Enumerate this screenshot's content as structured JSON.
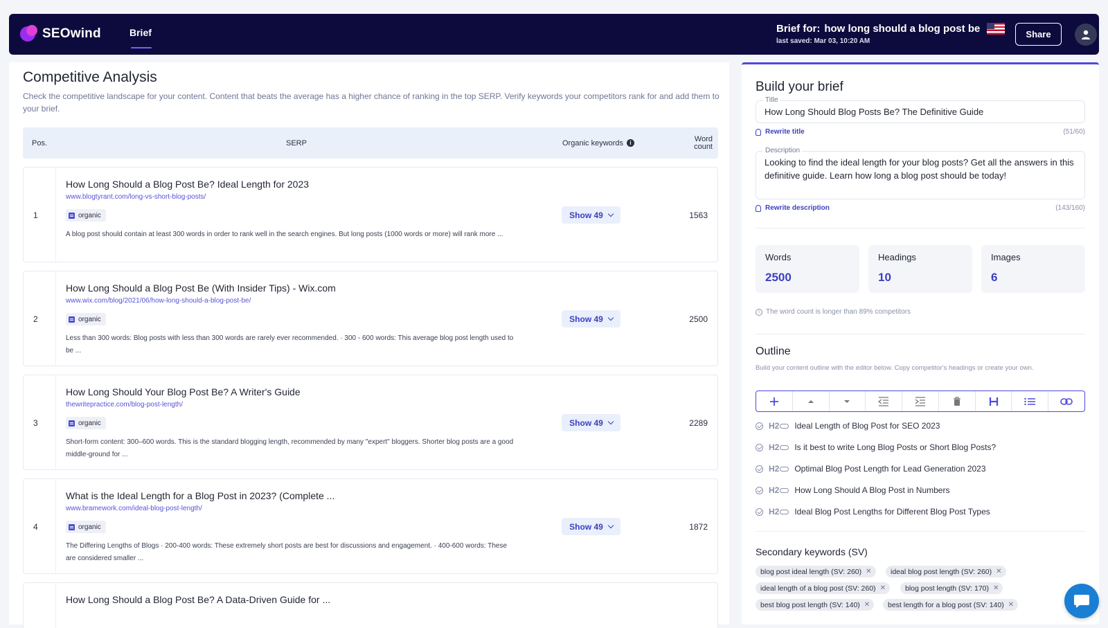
{
  "header": {
    "logo_text": "SEOwind",
    "nav_brief": "Brief",
    "brief_for_label": "Brief for:",
    "brief_keyword": "how long should a blog post be",
    "last_saved": "last saved: Mar 03, 10:20 AM",
    "share_label": "Share"
  },
  "left": {
    "title": "Competitive Analysis",
    "subtitle": "Check the competitive landscape for your content. Content that beats the average has a higher chance of ranking in the top SERP. Verify keywords your competitors rank for and add them to your brief.",
    "columns": {
      "pos": "Pos.",
      "serp": "SERP",
      "organic": "Organic keywords",
      "info": "i",
      "word_count": "Word count"
    },
    "rows": [
      {
        "pos": "1",
        "title": "How Long Should a Blog Post Be? Ideal Length for 2023",
        "url": "www.blogtyrant.com/long-vs-short-blog-posts/",
        "badge": "organic",
        "snippet": "A blog post should contain at least 300 words in order to rank well in the search engines. But long posts (1000 words or more) will rank more ...",
        "show": "Show 49",
        "wc": "1563"
      },
      {
        "pos": "2",
        "title": "How Long Should a Blog Post Be (With Insider Tips) - Wix.com",
        "url": "www.wix.com/blog/2021/06/how-long-should-a-blog-post-be/",
        "badge": "organic",
        "snippet": "Less than 300 words: Blog posts with less than 300 words are rarely ever recommended. · 300 - 600 words: This average blog post length used to be ...",
        "show": "Show 49",
        "wc": "2500"
      },
      {
        "pos": "3",
        "title": "How Long Should Your Blog Post Be? A Writer's Guide",
        "url": "thewritepractice.com/blog-post-length/",
        "badge": "organic",
        "snippet": "Short-form content: 300–600 words. This is the standard blogging length, recommended by many \"expert\" bloggers. Shorter blog posts are a good middle-ground for ...",
        "show": "Show 49",
        "wc": "2289"
      },
      {
        "pos": "4",
        "title": "What is the Ideal Length for a Blog Post in 2023? (Complete ...",
        "url": "www.bramework.com/ideal-blog-post-length/",
        "badge": "organic",
        "snippet": "The Differing Lengths of Blogs · 200-400 words: These extremely short posts are best for discussions and engagement. · 400-600 words: These are considered smaller ...",
        "show": "Show 49",
        "wc": "1872"
      },
      {
        "pos": "",
        "title": "How Long Should a Blog Post Be? A Data-Driven Guide for ...",
        "url": "",
        "badge": "",
        "snippet": "",
        "show": "",
        "wc": ""
      }
    ]
  },
  "right": {
    "title": "Build your brief",
    "title_label": "Title",
    "title_value": "How Long Should Blog Posts Be? The Definitive Guide",
    "rewrite_title": "Rewrite title",
    "title_counter": "(51/60)",
    "description_label": "Description",
    "description_value": "Looking to find the ideal length for your blog posts? Get all the answers in this definitive guide. Learn how long a blog post should be today!",
    "rewrite_description": "Rewrite description",
    "description_counter": "(143/160)",
    "stats": [
      {
        "label": "Words",
        "value": "2500"
      },
      {
        "label": "Headings",
        "value": "10"
      },
      {
        "label": "Images",
        "value": "6"
      }
    ],
    "word_note": "The word count is longer than 89% competitors",
    "outline_title": "Outline",
    "outline_sub": "Build your content outline with the editor below. Copy competitor's headings or create your own.",
    "toolbar_icons": [
      "plus-icon",
      "move-up-icon",
      "move-down-icon",
      "outdent-icon",
      "indent-icon",
      "trash-icon",
      "heading-icon",
      "list-icon",
      "link-icon"
    ],
    "outline_items": [
      {
        "tag": "H2",
        "text": "Ideal Length of Blog Post for SEO 2023"
      },
      {
        "tag": "H2",
        "text": "Is it best to write Long Blog Posts or Short Blog Posts?"
      },
      {
        "tag": "H2",
        "text": "Optimal Blog Post Length for Lead Generation 2023"
      },
      {
        "tag": "H2",
        "text": "How Long Should A Blog Post in Numbers"
      },
      {
        "tag": "H2",
        "text": "Ideal Blog Post Lengths for Different Blog Post Types"
      }
    ],
    "secondary_title": "Secondary keywords (SV)",
    "secondary_chips": [
      "blog post ideal length (SV: 260)",
      "ideal blog post length (SV: 260)",
      "ideal length of a blog post (SV: 260)",
      "blog post length (SV: 170)",
      "best blog post length (SV: 140)",
      "best length for a blog post (SV: 140)"
    ]
  },
  "colors": {
    "navbar": "#0d0b3d",
    "accent": "#4d49e0",
    "brand_pink": "#e23fd5",
    "chat": "#1a7fd4"
  }
}
